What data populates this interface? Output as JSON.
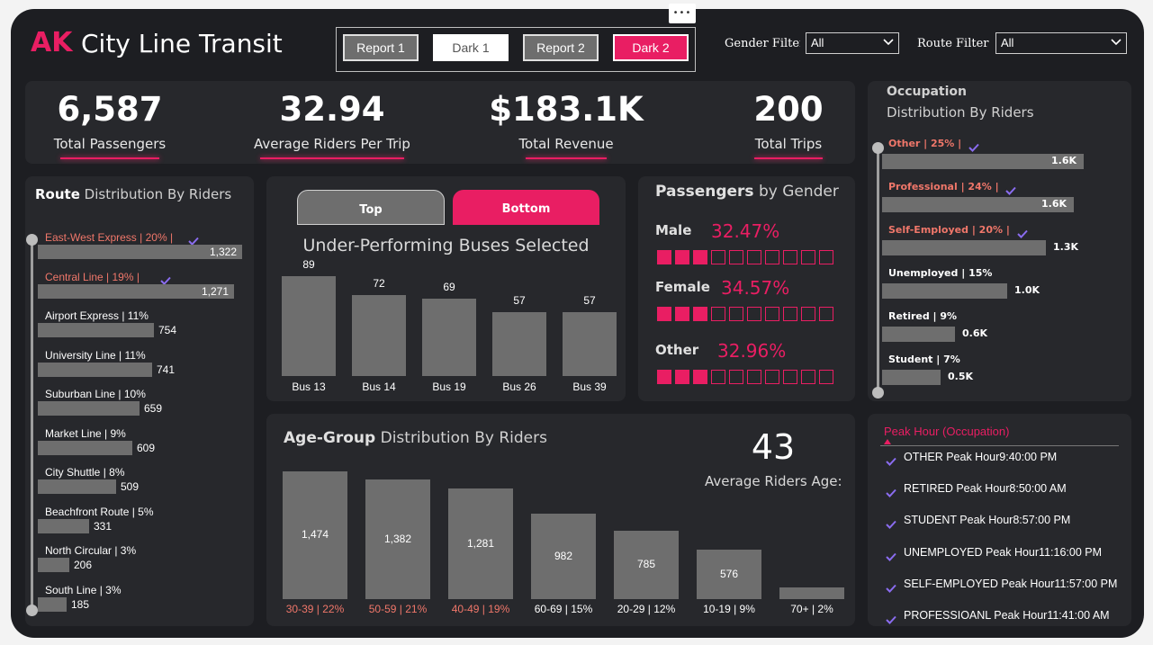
{
  "header": {
    "logo_mark": "AK",
    "title": "City Line Transit",
    "more_options": "•••",
    "nav_buttons": [
      "Report 1",
      "Dark 1",
      "Report 2",
      "Dark 2"
    ],
    "gender_filter_label": "Gender Filter",
    "gender_filter_value": "All",
    "route_filter_label": "Route Filter",
    "route_filter_value": "All"
  },
  "kpis": [
    {
      "value": "6,587",
      "label": "Total Passengers"
    },
    {
      "value": "32.94",
      "label": "Average Riders Per Trip"
    },
    {
      "value": "$183.1K",
      "label": "Total Revenue"
    },
    {
      "value": "200",
      "label": "Total Trips"
    }
  ],
  "route": {
    "title_bold": "Route",
    "title_rest": "Distribution By Riders",
    "items": [
      {
        "label": "East-West Express | 20% |",
        "value": "1,322",
        "checked": true
      },
      {
        "label": "Central Line | 19% |",
        "value": "1,271",
        "checked": true
      },
      {
        "label": "Airport Express | 11%",
        "value": "754",
        "checked": false
      },
      {
        "label": "University Line | 11%",
        "value": "741",
        "checked": false
      },
      {
        "label": "Suburban Line | 10%",
        "value": "659",
        "checked": false
      },
      {
        "label": "Market Line | 9%",
        "value": "609",
        "checked": false
      },
      {
        "label": "City Shuttle | 8%",
        "value": "509",
        "checked": false
      },
      {
        "label": "Beachfront Route | 5%",
        "value": "331",
        "checked": false
      },
      {
        "label": "North Circular | 3%",
        "value": "206",
        "checked": false
      },
      {
        "label": "South Line | 3%",
        "value": "185",
        "checked": false
      }
    ]
  },
  "buses": {
    "toggle": [
      "Top",
      "Bottom"
    ],
    "title": "Under-Performing Buses Selected"
  },
  "gender": {
    "title_bold": "Passengers",
    "title_rest": "by Gender",
    "items": [
      {
        "label": "Male",
        "pct": "32.47%",
        "filled": 3
      },
      {
        "label": "Female",
        "pct": "34.57%",
        "filled": 3
      },
      {
        "label": "Other",
        "pct": "32.96%",
        "filled": 3
      }
    ]
  },
  "occupation": {
    "title_bold": "Occupation",
    "title_rest": "Distribution By Riders",
    "items": [
      {
        "label": "Other | 25% |",
        "value": "1.6K",
        "checked": true
      },
      {
        "label": "Professional | 24% |",
        "value": "1.6K",
        "checked": true
      },
      {
        "label": "Self-Employed | 20% |",
        "value": "1.3K",
        "checked": true
      },
      {
        "label": "Unemployed | 15%",
        "value": "1.0K",
        "checked": false
      },
      {
        "label": "Retired | 9%",
        "value": "0.6K",
        "checked": false
      },
      {
        "label": "Student | 7%",
        "value": "0.5K",
        "checked": false
      }
    ]
  },
  "age": {
    "title_bold": "Age-Group",
    "title_rest": "Distribution By Riders",
    "avg_value": "43",
    "avg_label": "Average Riders Age:"
  },
  "peak": {
    "title": "Peak Hour (Occupation)",
    "items": [
      "OTHER Peak Hour9:40:00 PM",
      "RETIRED Peak Hour8:50:00 AM",
      "STUDENT Peak Hour8:57:00 PM",
      "UNEMPLOYED Peak Hour11:16:00 PM",
      "SELF-EMPLOYED Peak Hour11:57:00 PM",
      "PROFESSIOANL Peak Hour11:41:00 AM"
    ]
  },
  "colors": {
    "accent": "#e91e63",
    "bar": "#6e6e6e",
    "background": "#1d1e22",
    "card": "#27282c",
    "highlight_label": "#f0776a",
    "check": "#8a6cf0"
  },
  "chart_data": [
    {
      "type": "bar",
      "title": "Under-Performing Buses Selected",
      "categories": [
        "Bus 13",
        "Bus 14",
        "Bus 19",
        "Bus 26",
        "Bus 39"
      ],
      "values": [
        89,
        72,
        69,
        57,
        57
      ]
    },
    {
      "type": "bar",
      "title": "Age-Group Distribution By Riders",
      "categories": [
        "30-39 | 22%",
        "50-59 | 21%",
        "40-49 | 19%",
        "60-69 | 15%",
        "20-29 | 12%",
        "10-19 | 9%",
        "70+ | 2%"
      ],
      "values": [
        1474,
        1382,
        1281,
        982,
        785,
        576,
        130
      ],
      "data_labels": [
        "1,474",
        "1,382",
        "1,281",
        "982",
        "785",
        "576",
        ""
      ],
      "highlighted": [
        true,
        true,
        true,
        false,
        false,
        false,
        false
      ]
    },
    {
      "type": "bar",
      "title": "Route Distribution By Riders",
      "categories": [
        "East-West Express",
        "Central Line",
        "Airport Express",
        "University Line",
        "Suburban Line",
        "Market Line",
        "City Shuttle",
        "Beachfront Route",
        "North Circular",
        "South Line"
      ],
      "values": [
        1322,
        1271,
        754,
        741,
        659,
        609,
        509,
        331,
        206,
        185
      ]
    },
    {
      "type": "bar",
      "title": "Occupation Distribution By Riders",
      "categories": [
        "Other",
        "Professional",
        "Self-Employed",
        "Unemployed",
        "Retired",
        "Student"
      ],
      "values": [
        1600,
        1550,
        1300,
        1000,
        600,
        500
      ]
    }
  ]
}
